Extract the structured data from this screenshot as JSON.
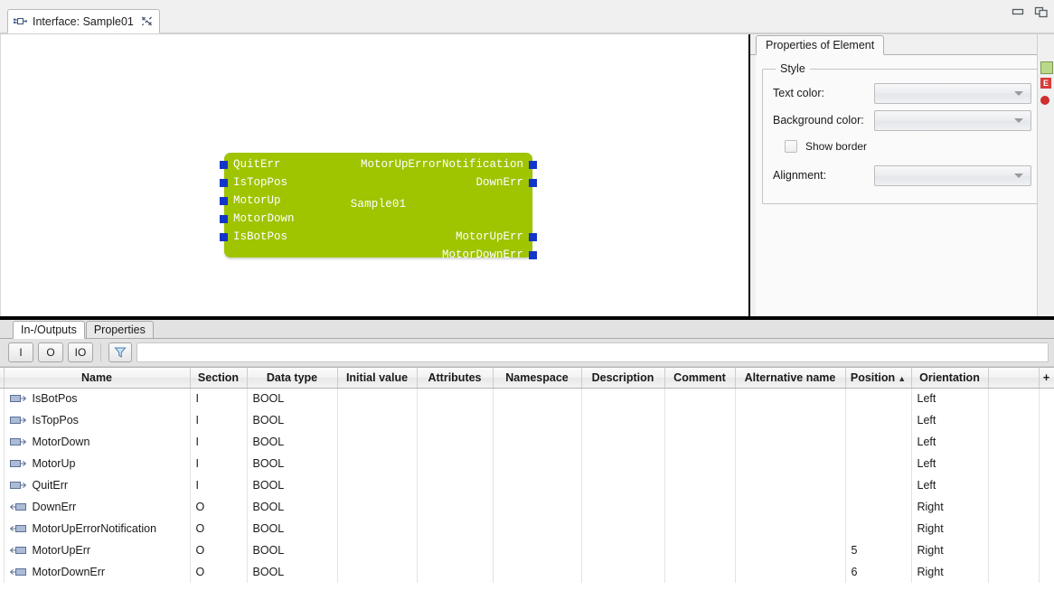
{
  "window": {
    "tab_title": "Interface: Sample01",
    "tab_icon": "interface-icon",
    "close_icon": "close-icon",
    "minimize_icon": "minimize-icon",
    "maximize_icon": "maximize-icon"
  },
  "canvas": {
    "block": {
      "title": "Sample01",
      "fill_color": "#9fc400",
      "port_color": "#1335c8",
      "text_color": "#ffffff",
      "inputs": [
        {
          "label": "QuitErr"
        },
        {
          "label": "IsTopPos"
        },
        {
          "label": "MotorUp"
        },
        {
          "label": "MotorDown"
        },
        {
          "label": "IsBotPos"
        }
      ],
      "outputs": [
        {
          "label": "MotorUpErrorNotification"
        },
        {
          "label": "DownErr"
        },
        {
          "label": "MotorUpErr"
        },
        {
          "label": "MotorDownErr"
        }
      ]
    }
  },
  "properties_panel": {
    "tab_label": "Properties of Element",
    "group_title": "Style",
    "fields": {
      "text_color_label": "Text color:",
      "text_color_value": "",
      "background_color_label": "Background color:",
      "background_color_value": "",
      "show_border_label": "Show border",
      "show_border_checked": false,
      "alignment_label": "Alignment:",
      "alignment_value": ""
    }
  },
  "bottom_panel": {
    "tabs": [
      {
        "label": "In-/Outputs",
        "active": true
      },
      {
        "label": "Properties",
        "active": false
      }
    ],
    "toolbar": {
      "buttons": [
        {
          "label": "I",
          "name": "filter-inputs-button"
        },
        {
          "label": "O",
          "name": "filter-outputs-button"
        },
        {
          "label": "IO",
          "name": "filter-inouts-button"
        }
      ],
      "filter_icon": "funnel-icon",
      "filter_input_value": "",
      "filter_input_placeholder": ""
    },
    "table": {
      "columns": [
        {
          "label": "Name",
          "sort": ""
        },
        {
          "label": "Section",
          "sort": ""
        },
        {
          "label": "Data type",
          "sort": ""
        },
        {
          "label": "Initial value",
          "sort": ""
        },
        {
          "label": "Attributes",
          "sort": ""
        },
        {
          "label": "Namespace",
          "sort": ""
        },
        {
          "label": "Description",
          "sort": ""
        },
        {
          "label": "Comment",
          "sort": ""
        },
        {
          "label": "Alternative name",
          "sort": ""
        },
        {
          "label": "Position",
          "sort": "▲"
        },
        {
          "label": "Orientation",
          "sort": ""
        },
        {
          "label": "",
          "sort": ""
        },
        {
          "label": "+",
          "sort": ""
        }
      ],
      "rows": [
        {
          "icon": "input-pin-icon",
          "name": "IsBotPos",
          "section": "I",
          "data_type": "BOOL",
          "initial_value": "",
          "attributes": "",
          "namespace": "",
          "description": "",
          "comment": "",
          "alternative_name": "",
          "position": "",
          "orientation": "Left"
        },
        {
          "icon": "input-pin-icon",
          "name": "IsTopPos",
          "section": "I",
          "data_type": "BOOL",
          "initial_value": "",
          "attributes": "",
          "namespace": "",
          "description": "",
          "comment": "",
          "alternative_name": "",
          "position": "",
          "orientation": "Left"
        },
        {
          "icon": "input-pin-icon",
          "name": "MotorDown",
          "section": "I",
          "data_type": "BOOL",
          "initial_value": "",
          "attributes": "",
          "namespace": "",
          "description": "",
          "comment": "",
          "alternative_name": "",
          "position": "",
          "orientation": "Left"
        },
        {
          "icon": "input-pin-icon",
          "name": "MotorUp",
          "section": "I",
          "data_type": "BOOL",
          "initial_value": "",
          "attributes": "",
          "namespace": "",
          "description": "",
          "comment": "",
          "alternative_name": "",
          "position": "",
          "orientation": "Left"
        },
        {
          "icon": "input-pin-icon",
          "name": "QuitErr",
          "section": "I",
          "data_type": "BOOL",
          "initial_value": "",
          "attributes": "",
          "namespace": "",
          "description": "",
          "comment": "",
          "alternative_name": "",
          "position": "",
          "orientation": "Left"
        },
        {
          "icon": "output-pin-icon",
          "name": "DownErr",
          "section": "O",
          "data_type": "BOOL",
          "initial_value": "",
          "attributes": "",
          "namespace": "",
          "description": "",
          "comment": "",
          "alternative_name": "",
          "position": "",
          "orientation": "Right"
        },
        {
          "icon": "output-pin-icon",
          "name": "MotorUpErrorNotification",
          "section": "O",
          "data_type": "BOOL",
          "initial_value": "",
          "attributes": "",
          "namespace": "",
          "description": "",
          "comment": "",
          "alternative_name": "",
          "position": "",
          "orientation": "Right"
        },
        {
          "icon": "output-pin-icon",
          "name": "MotorUpErr",
          "section": "O",
          "data_type": "BOOL",
          "initial_value": "",
          "attributes": "",
          "namespace": "",
          "description": "",
          "comment": "",
          "alternative_name": "",
          "position": "5",
          "orientation": "Right"
        },
        {
          "icon": "output-pin-icon",
          "name": "MotorDownErr",
          "section": "O",
          "data_type": "BOOL",
          "initial_value": "",
          "attributes": "",
          "namespace": "",
          "description": "",
          "comment": "",
          "alternative_name": "",
          "position": "6",
          "orientation": "Right"
        }
      ]
    }
  }
}
